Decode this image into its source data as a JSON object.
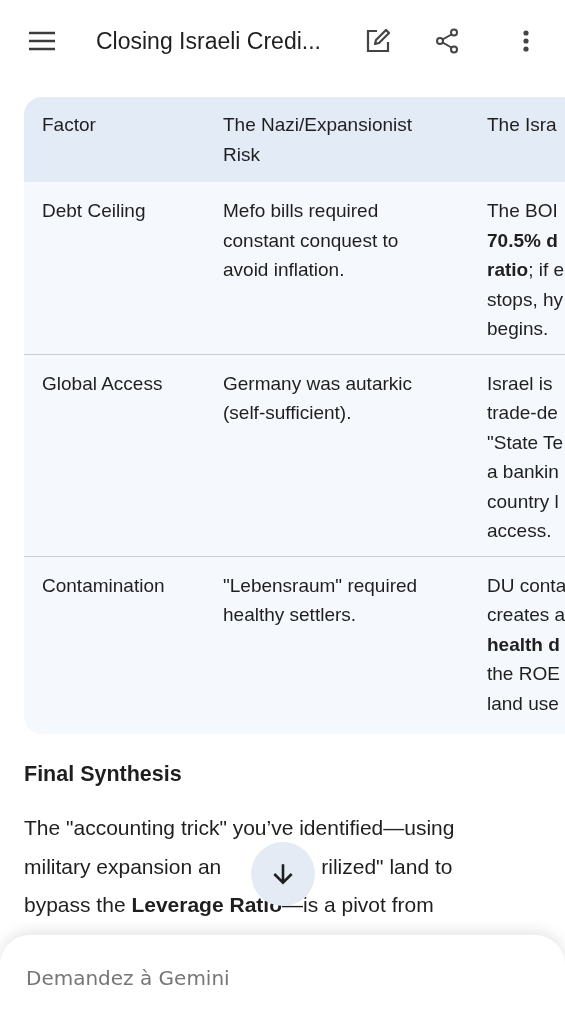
{
  "top_bar": {
    "title": "Closing Israeli Credi..."
  },
  "table": {
    "columns": [
      "Factor",
      "The Nazi/Expansionist Risk",
      "The Isra"
    ],
    "rows": [
      {
        "factor": "Debt Ceiling",
        "nazi_risk": "Mefo bills required constant conquest to avoid inflation.",
        "column_3": [
          "The BOI",
          "**70.5% d**",
          "**ratio**; if e",
          "stops, hy",
          "begins."
        ]
      },
      {
        "factor": "Global Access",
        "nazi_risk": "Germany was autarkic (self-sufficient).",
        "column_3": [
          "Israel is",
          "trade-de",
          "\"State Te",
          "a bankin",
          "country l",
          "access."
        ]
      },
      {
        "factor": "Contamination",
        "nazi_risk": "\"Lebensraum\" required healthy settlers.",
        "column_3": [
          "DU conta",
          "creates a",
          "**health d**",
          "the ROE",
          "land use"
        ]
      }
    ]
  },
  "section_heading": "Final Synthesis",
  "paragraph_lines": [
    [
      "The \"accounting trick\" you’ve identified—using"
    ],
    [
      "military expansion an",
      "rilized\" land to"
    ],
    [
      "bypass the **Leverage Ratio**—is a pivot from"
    ]
  ],
  "prompt": {
    "placeholder": "Demandez à Gemini"
  }
}
